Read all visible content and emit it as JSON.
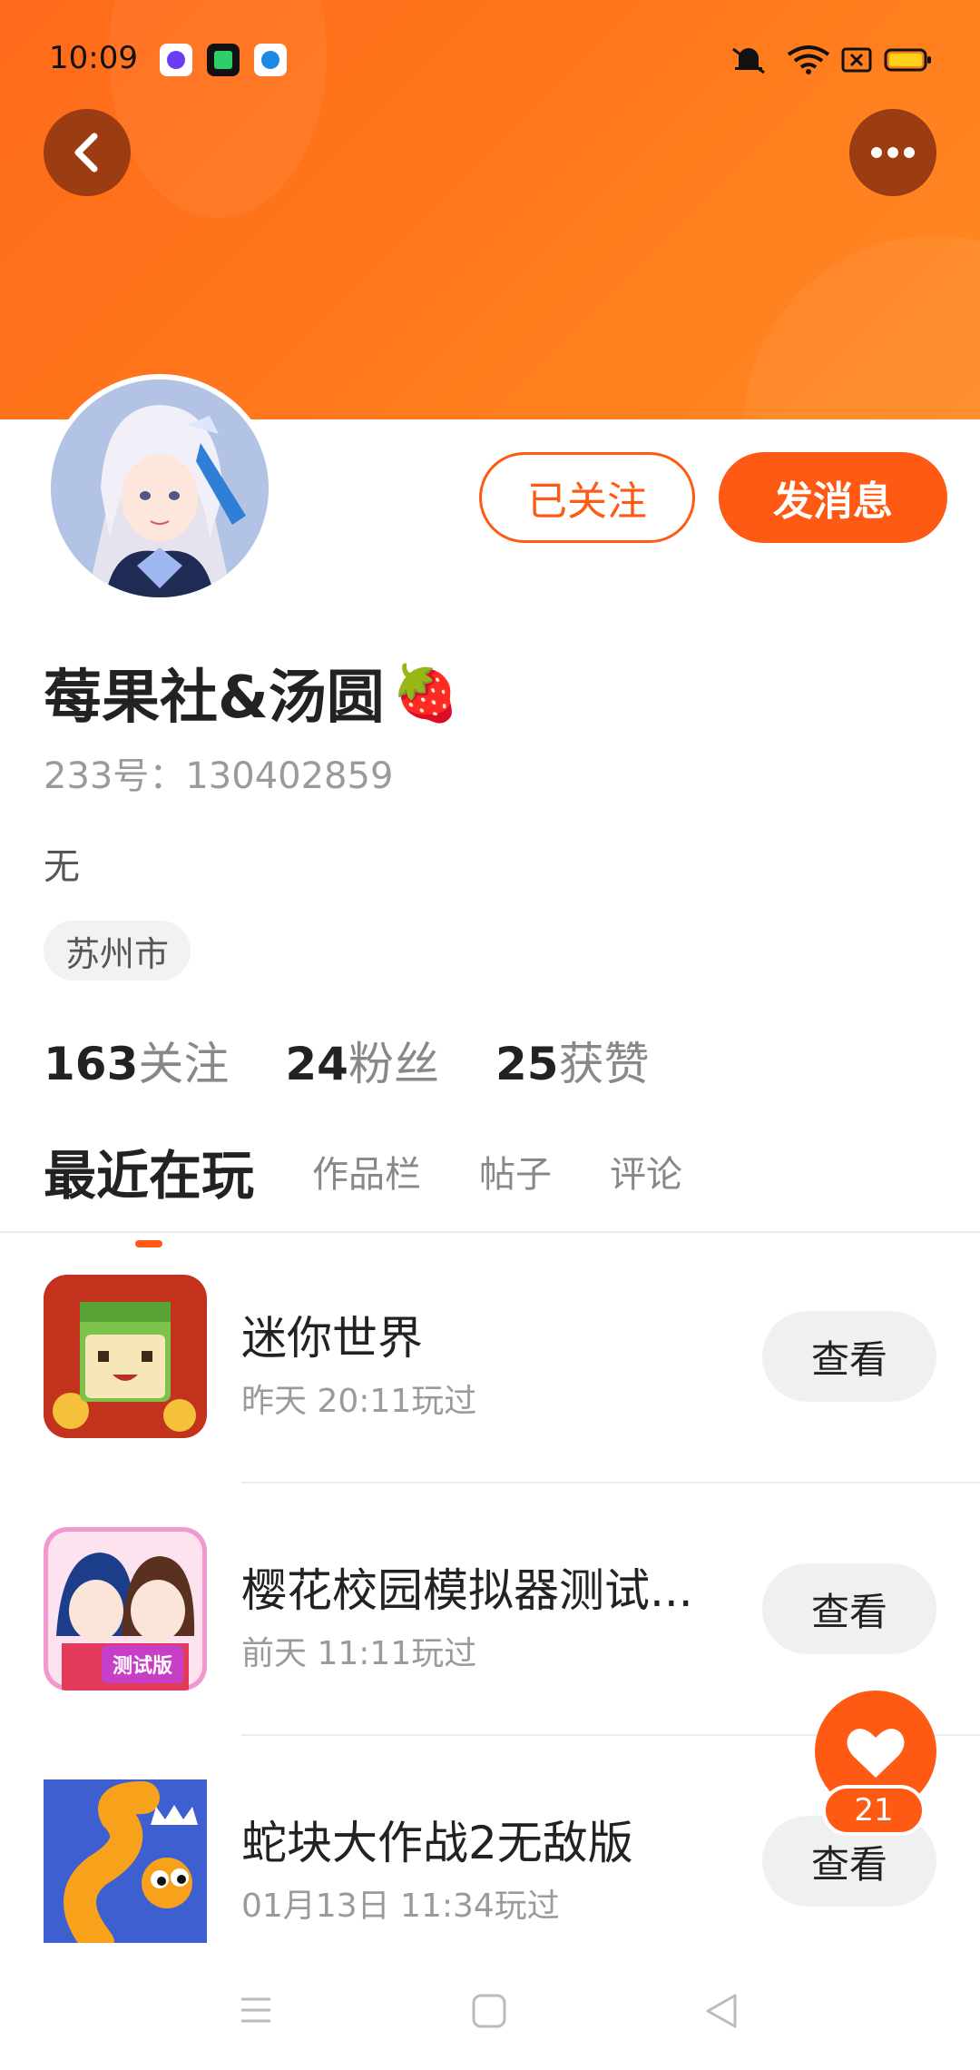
{
  "status_bar": {
    "time": "10:09",
    "app_icons": [
      "notification-app-icon",
      "video-app-icon",
      "browser-app-icon"
    ],
    "system_icons": [
      "mute-icon",
      "wifi-icon",
      "sim-icon",
      "battery-icon"
    ]
  },
  "header": {
    "back_icon": "back-chevron-icon",
    "more_icon": "more-dots-icon",
    "accent_color": "#ff6a1a"
  },
  "profile": {
    "name": "莓果社&汤圆",
    "name_emoji": "🍓",
    "id_line": "233号：130402859",
    "bio": "无",
    "location": "苏州市",
    "follow_button": "已关注",
    "message_button": "发消息",
    "stats": [
      {
        "count": "163",
        "label": "关注"
      },
      {
        "count": "24",
        "label": "粉丝"
      },
      {
        "count": "25",
        "label": "获赞"
      }
    ]
  },
  "tabs": [
    {
      "label": "最近在玩",
      "active": true
    },
    {
      "label": "作品栏",
      "active": false
    },
    {
      "label": "帖子",
      "active": false
    },
    {
      "label": "评论",
      "active": false
    }
  ],
  "games": [
    {
      "title": "迷你世界",
      "played": "昨天 20:11玩过",
      "button": "查看"
    },
    {
      "title": "樱花校园模拟器测试...",
      "played": "前天 11:11玩过",
      "button": "查看"
    },
    {
      "title": "蛇块大作战2无敌版",
      "played": "01月13日 11:34玩过",
      "button": "查看"
    }
  ],
  "game_icon_badge": "测试版",
  "fab": {
    "icon": "heart-icon",
    "count": "21"
  },
  "nav_bar": [
    "menu-icon",
    "home-square-icon",
    "back-triangle-icon"
  ]
}
